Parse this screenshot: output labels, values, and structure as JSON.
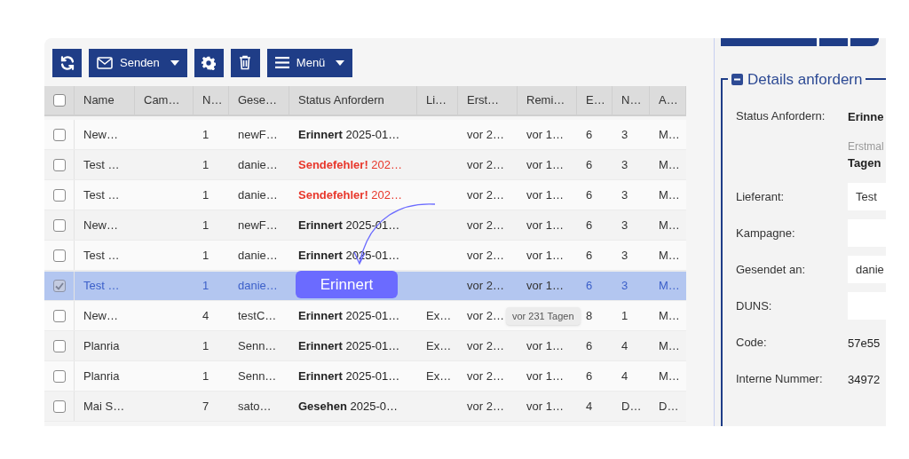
{
  "toolbar": [
    {
      "kind": "refresh"
    },
    {
      "kind": "mail",
      "label": "Senden",
      "dropdown": true
    },
    {
      "kind": "settings"
    },
    {
      "kind": "trash"
    },
    {
      "kind": "menu",
      "label": "Menü",
      "dropdown": true
    }
  ],
  "table": {
    "select_all": false,
    "columns": [
      "Name",
      "Cam…",
      "N…",
      "Gese…",
      "Status Anfordern",
      "Li…",
      "Erst…",
      "Remi…",
      "E…",
      "N…",
      "A…"
    ],
    "rows": [
      {
        "selected": false,
        "error": false,
        "cells": [
          "New…",
          "",
          "1",
          "newF…",
          "**Erinnert** 2025-01…",
          "",
          "vor 2…",
          "vor 1…",
          "6",
          "3",
          "M…"
        ]
      },
      {
        "selected": false,
        "error": true,
        "cells": [
          "Test …",
          "",
          "1",
          "danie…",
          "**Sendefehler!** 202…",
          "",
          "vor 2…",
          "vor 1…",
          "6",
          "3",
          "M…"
        ]
      },
      {
        "selected": false,
        "error": true,
        "cells": [
          "Test …",
          "",
          "1",
          "danie…",
          "**Sendefehler!** 202…",
          "",
          "vor 2…",
          "vor 1…",
          "6",
          "3",
          "M…"
        ]
      },
      {
        "selected": false,
        "error": false,
        "cells": [
          "New…",
          "",
          "1",
          "newF…",
          "**Erinnert** 2025-01…",
          "",
          "vor 2…",
          "vor 1…",
          "6",
          "3",
          "M…"
        ]
      },
      {
        "selected": false,
        "error": false,
        "cells": [
          "Test …",
          "",
          "1",
          "danie…",
          "**Erinnert** 2025-01…",
          "",
          "vor 2…",
          "vor 1…",
          "6",
          "3",
          "M…"
        ]
      },
      {
        "selected": true,
        "cells": [
          "Test …",
          "",
          "1",
          "danie…",
          "",
          "",
          "vor 2…",
          "vor 1…",
          "6",
          "3",
          "M…"
        ]
      },
      {
        "selected": false,
        "error": false,
        "cells": [
          "New…",
          "",
          "4",
          "testC…",
          "**Erinnert** 2025-01…",
          "Ex…",
          "vor 2…",
          "",
          "8",
          "1",
          "M…"
        ]
      },
      {
        "selected": false,
        "error": false,
        "cells": [
          "Planria",
          "",
          "1",
          "Senn…",
          "**Erinnert** 2025-01…",
          "Ex…",
          "vor 2…",
          "vor 1…",
          "6",
          "4",
          "M…"
        ]
      },
      {
        "selected": false,
        "error": false,
        "cells": [
          "Planria",
          "",
          "1",
          "Senn…",
          "**Erinnert** 2025-01…",
          "Ex…",
          "vor 2…",
          "vor 1…",
          "6",
          "4",
          "M…"
        ]
      },
      {
        "selected": false,
        "error": false,
        "cells": [
          "Mai S…",
          "",
          "7",
          "sato…",
          "**Gesehen** 2025-0…",
          "",
          "vor 2…",
          "vor 1…",
          "4",
          "D…",
          "D…"
        ]
      }
    ]
  },
  "callout": {
    "label": "Erinnert"
  },
  "tooltip": {
    "text": "vor 231 Tagen"
  },
  "details": {
    "title": "Details anfordern",
    "rows": [
      {
        "label": "Status Anfordern:",
        "kind": "bold",
        "value": "Erinne"
      },
      {
        "label": "",
        "kind": "note",
        "value": "Erstmal",
        "value_2": "Tagen"
      },
      {
        "label": "Lieferant:",
        "kind": "field",
        "value": "Test"
      },
      {
        "label": "Kampagne:",
        "kind": "field",
        "value": ""
      },
      {
        "label": "Gesendet an:",
        "kind": "field",
        "value": "danie"
      },
      {
        "label": "DUNS:",
        "kind": "field",
        "value": ""
      },
      {
        "label": "Code:",
        "kind": "text",
        "value": "57e55"
      },
      {
        "label": "Interne Nummer:",
        "kind": "text",
        "value": "34972"
      }
    ]
  }
}
